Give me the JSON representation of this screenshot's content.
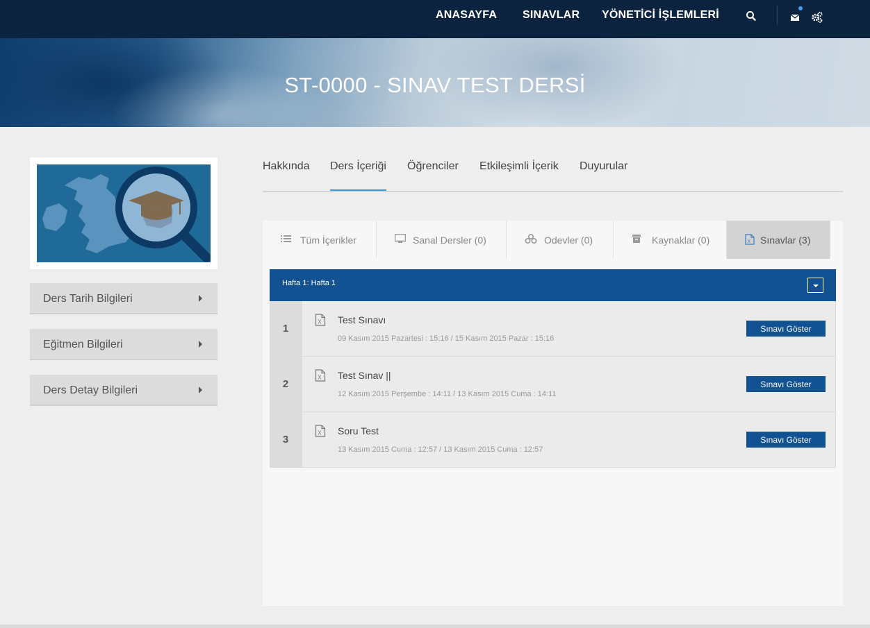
{
  "nav": {
    "links": [
      "ANASAYFA",
      "SINAVLAR",
      "YÖNETİCİ İŞLEMLERİ"
    ],
    "icons": [
      "search-icon",
      "envelope-icon",
      "gears-icon"
    ],
    "notification_dot_color": "#3ea0f0"
  },
  "banner": {
    "title": "ST-0000 - SINAV TEST DERSİ"
  },
  "sidebar": {
    "items": [
      {
        "label": "Ders Tarih Bilgileri"
      },
      {
        "label": "Eğitmen Bilgileri"
      },
      {
        "label": "Ders Detay Bilgileri"
      }
    ]
  },
  "tabs": [
    {
      "label": "Hakkında",
      "active": false
    },
    {
      "label": "Ders İçeriği",
      "active": true
    },
    {
      "label": "Öğrenciler",
      "active": false
    },
    {
      "label": "Etkileşimli İçerik",
      "active": false
    },
    {
      "label": "Duyurular",
      "active": false
    }
  ],
  "subtabs": [
    {
      "label": "Tüm İçerikler",
      "icon": "list-icon",
      "active": false
    },
    {
      "label": "Sanal Dersler (0)",
      "icon": "monitor-icon",
      "active": false
    },
    {
      "label": "Odevler (0)",
      "icon": "cubes-icon",
      "active": false
    },
    {
      "label": "Kaynaklar (0)",
      "icon": "archive-icon",
      "active": false
    },
    {
      "label": "Sınavlar (3)",
      "icon": "excel-file-icon",
      "active": true
    }
  ],
  "week": {
    "title": "Hafta 1: Hafta 1"
  },
  "exams": [
    {
      "number": "1",
      "title": "Test Sınavı",
      "date": "09 Kasım 2015 Pazartesi : 15:16 / 15 Kasım 2015 Pazar : 15:16",
      "button": "Sınavı Göster"
    },
    {
      "number": "2",
      "title": "Test Sınav ||",
      "date": "12 Kasım 2015 Perşembe : 14:11 / 13 Kasım 2015 Cuma : 14:11",
      "button": "Sınavı Göster"
    },
    {
      "number": "3",
      "title": "Soru Test",
      "date": "13 Kasım 2015 Cuma : 12:57 / 13 Kasım 2015 Cuma : 12:57",
      "button": "Sınavı Göster"
    }
  ],
  "colors": {
    "nav_bg": "#0c2340",
    "accent_blue": "#125192",
    "tab_underline": "#3a9ad9"
  }
}
